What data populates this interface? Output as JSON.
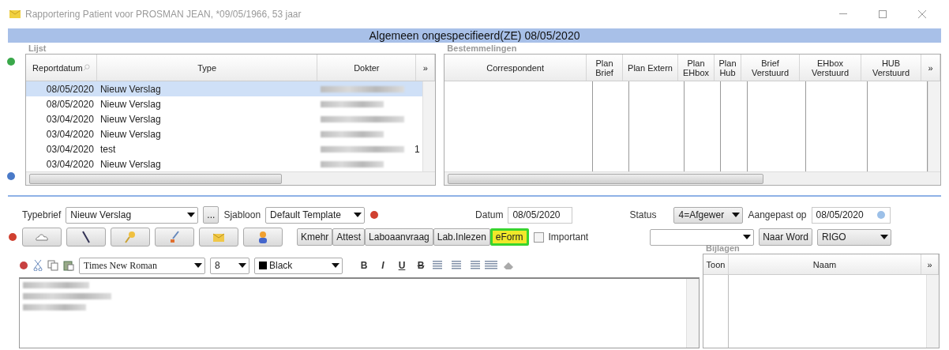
{
  "window": {
    "title": "Rapportering Patient voor PROSMAN JEAN, *09/05/1966, 53 jaar"
  },
  "header": "Algemeen ongespecifieerd(ZE) 08/05/2020",
  "lijst": {
    "label": "Lijst",
    "columns": [
      "Reportdatum",
      "Type",
      "Dokter"
    ],
    "more": "»",
    "rows": [
      {
        "date": "08/05/2020",
        "type": "Nieuw Verslag",
        "selected": true
      },
      {
        "date": "08/05/2020",
        "type": "Nieuw Verslag",
        "selected": false
      },
      {
        "date": "03/04/2020",
        "type": "Nieuw Verslag",
        "selected": false
      },
      {
        "date": "03/04/2020",
        "type": "Nieuw Verslag",
        "selected": false
      },
      {
        "date": "03/04/2020",
        "type": "test",
        "selected": false,
        "column_4": "1"
      },
      {
        "date": "03/04/2020",
        "type": "Nieuw Verslag",
        "selected": false
      }
    ]
  },
  "bestemmelingen": {
    "label": "Bestemmelingen",
    "columns": [
      "Correspondent",
      "Plan Brief",
      "Plan Extern",
      "Plan EHbox",
      "Plan Hub",
      "Brief Verstuurd",
      "EHbox Verstuurd",
      "HUB Verstuurd"
    ],
    "more": "»"
  },
  "form": {
    "typebrief_label": "Typebrief",
    "typebrief": "Nieuw Verslag",
    "browse": "...",
    "sjabloon_label": "Sjabloon",
    "sjabloon": "Default Template",
    "datum_label": "Datum",
    "datum": "08/05/2020",
    "status_label": "Status",
    "status": "4=Afgewer",
    "aangepast_label": "Aangepast op",
    "aangepast": "08/05/2020"
  },
  "actions": [
    {
      "label": "Kmehr",
      "selected": false
    },
    {
      "label": "Attest",
      "selected": false
    },
    {
      "label": "Laboaanvraag",
      "selected": false
    },
    {
      "label": "Lab.Inlezen",
      "selected": false
    },
    {
      "label": "eForm",
      "selected": true
    }
  ],
  "important": {
    "label": "Important",
    "checked": false
  },
  "naar_word": "Naar Word",
  "rigo": "RIGO",
  "editor": {
    "font": "Times New Roman",
    "size": "8",
    "color_name": "Black",
    "format_buttons": [
      "B",
      "I",
      "U",
      "B"
    ]
  },
  "bijlagen": {
    "label": "Bijlagen",
    "columns": [
      "Toon",
      "Naam"
    ],
    "more": "»"
  }
}
